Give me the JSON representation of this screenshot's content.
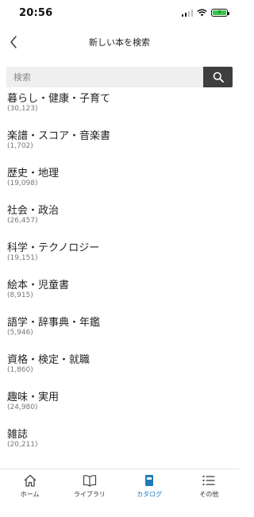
{
  "status_bar": {
    "time": "20:56"
  },
  "header": {
    "title": "新しい本を検索"
  },
  "search": {
    "placeholder": "検索"
  },
  "categories": [
    {
      "name": "暮らし・健康・子育て",
      "count": "(30,123)"
    },
    {
      "name": "楽譜・スコア・音楽書",
      "count": "(1,702)"
    },
    {
      "name": "歴史・地理",
      "count": "(19,098)"
    },
    {
      "name": "社会・政治",
      "count": "(26,457)"
    },
    {
      "name": "科学・テクノロジー",
      "count": "(19,151)"
    },
    {
      "name": "絵本・児童書",
      "count": "(8,915)"
    },
    {
      "name": "語学・辞事典・年鑑",
      "count": "(5,946)"
    },
    {
      "name": "資格・検定・就職",
      "count": "(1,860)"
    },
    {
      "name": "趣味・実用",
      "count": "(24,980)"
    },
    {
      "name": "雑誌",
      "count": "(20,211)"
    }
  ],
  "tabs": [
    {
      "label": "ホーム",
      "icon": "home-icon"
    },
    {
      "label": "ライブラリ",
      "icon": "book-icon"
    },
    {
      "label": "カタログ",
      "icon": "catalog-icon"
    },
    {
      "label": "その他",
      "icon": "menu-icon"
    }
  ],
  "colors": {
    "accent": "#1f7ab8",
    "search_button": "#3e3e3e",
    "battery": "#36c64a"
  }
}
